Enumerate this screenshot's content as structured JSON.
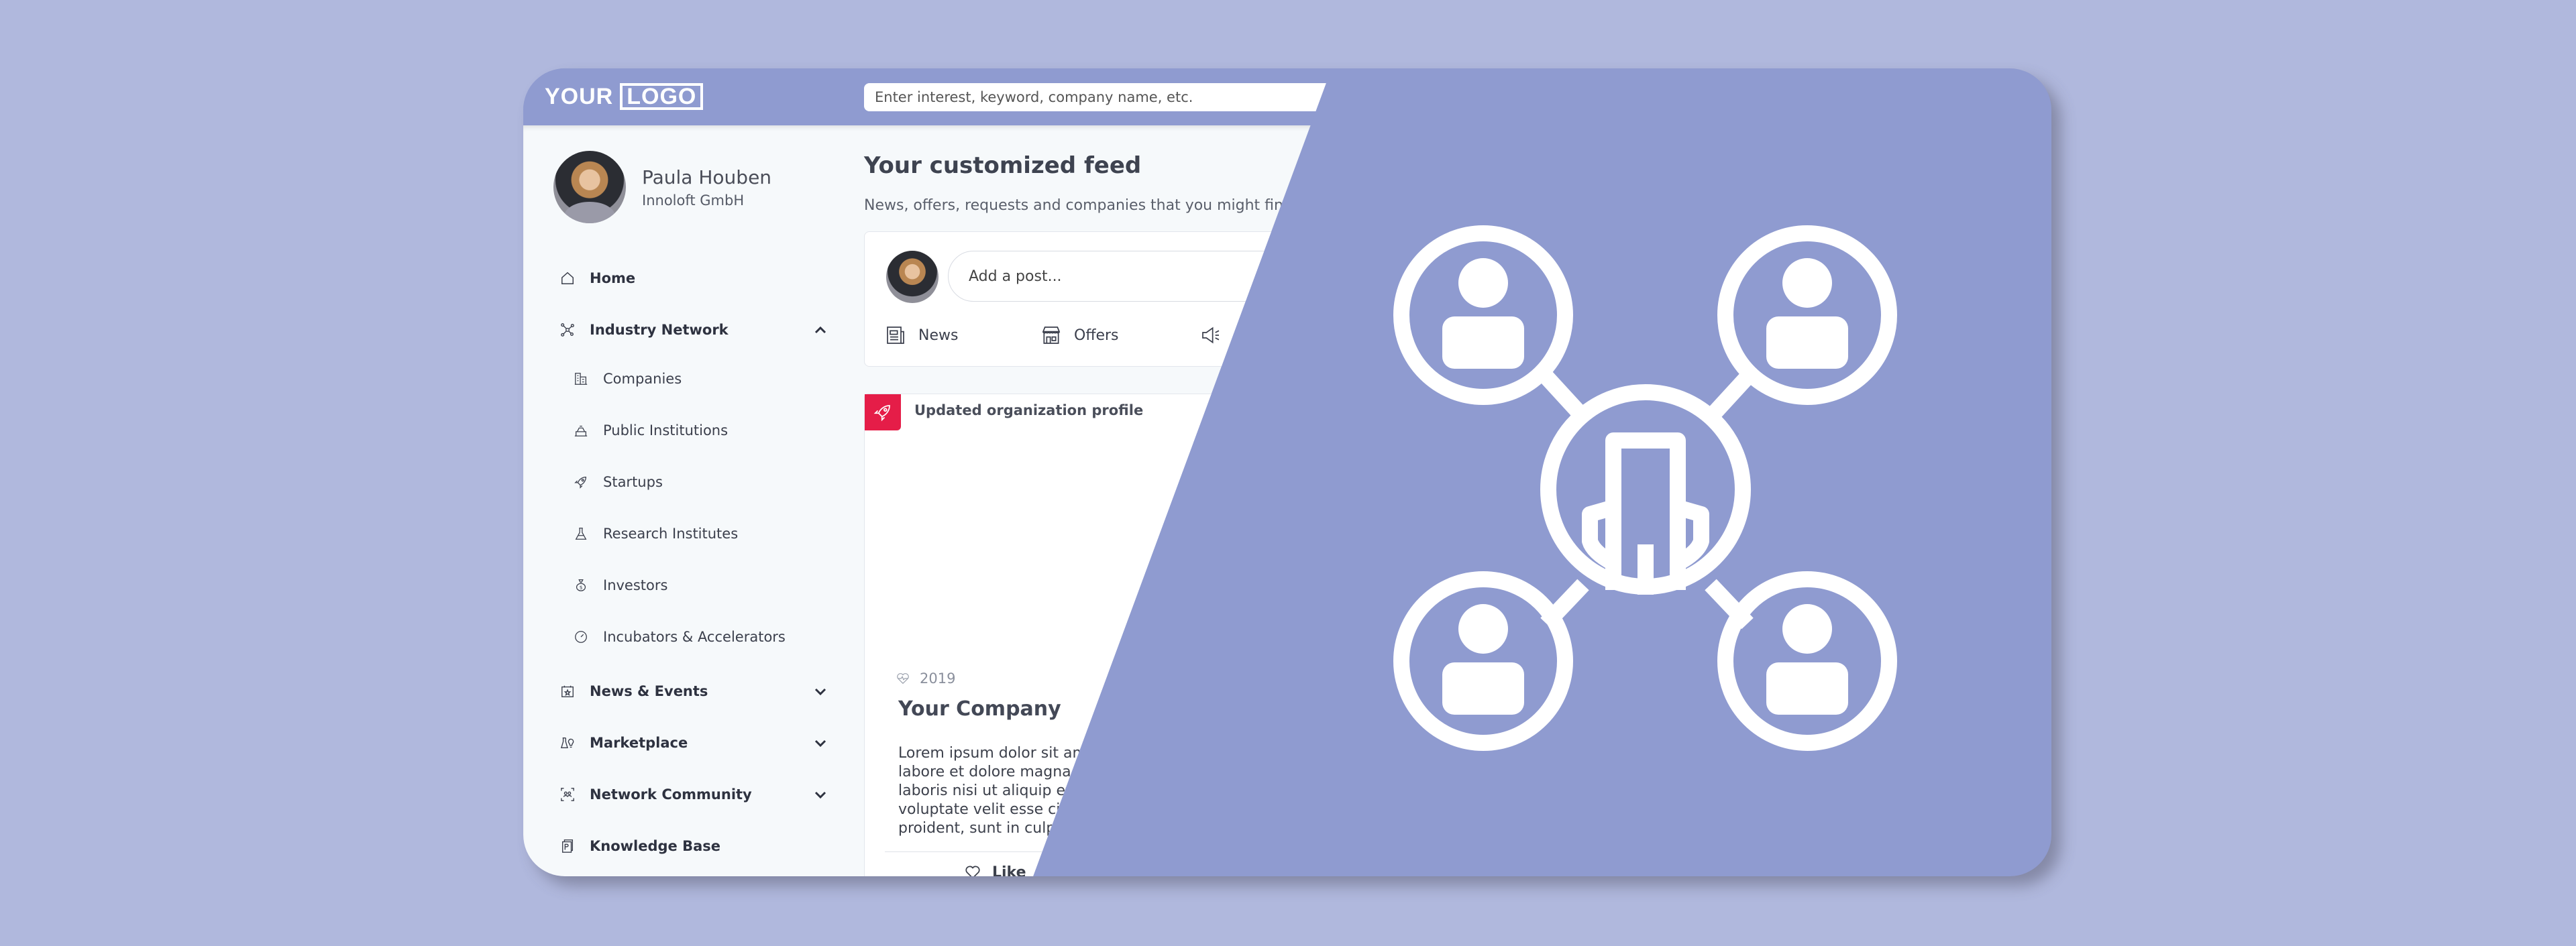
{
  "colors": {
    "background": "#b0b8dd",
    "brand": "#8f9bd0",
    "panel": "#f6f9fb",
    "accent_red": "#e51d48",
    "text_dark": "#2e3240"
  },
  "header": {
    "logo_text_plain": "YOUR",
    "logo_text_boxed": "LOGO",
    "search_placeholder": "Enter interest, keyword, company name, etc."
  },
  "profile": {
    "name": "Paula Houben",
    "organization": "Innoloft GmbH"
  },
  "sidebar": {
    "items": [
      {
        "label": "Home",
        "icon": "home-icon"
      },
      {
        "label": "Industry Network",
        "icon": "network-icon",
        "expanded": true,
        "children": [
          {
            "label": "Companies",
            "icon": "buildings-icon"
          },
          {
            "label": "Public Institutions",
            "icon": "institution-icon"
          },
          {
            "label": "Startups",
            "icon": "rocket-icon"
          },
          {
            "label": "Research Institutes",
            "icon": "flask-icon"
          },
          {
            "label": "Investors",
            "icon": "money-bag-icon"
          },
          {
            "label": "Incubators & Accelerators",
            "icon": "speedometer-icon"
          }
        ]
      },
      {
        "label": "News & Events",
        "icon": "calendar-star-icon",
        "expanded": false
      },
      {
        "label": "Marketplace",
        "icon": "marketplace-icon",
        "expanded": false
      },
      {
        "label": "Network Community",
        "icon": "community-icon",
        "expanded": false
      },
      {
        "label": "Knowledge Base",
        "icon": "book-icon"
      }
    ]
  },
  "feed": {
    "title": "Your customized feed",
    "subtitle": "News, offers, requests and companies that you might find",
    "composer": {
      "placeholder": "Add a post...",
      "actions": [
        {
          "label": "News",
          "icon": "newspaper-icon"
        },
        {
          "label": "Offers",
          "icon": "store-icon"
        },
        {
          "label": "",
          "icon": "megaphone-icon"
        }
      ]
    },
    "card": {
      "header": "Updated organization profile",
      "badge_icon": "rocket-icon",
      "year": "2019",
      "company": "Your Company",
      "body": "Lorem ipsum dolor sit am\nlabore et dolore magna a\nlaboris nisi ut aliquip ex\nvoluptate velit esse cillu\nproident, sunt in culpa",
      "like_label": "Like"
    }
  },
  "illustration": {
    "description": "network-diagram",
    "center_node": "building-icon",
    "outer_nodes": [
      "person-icon",
      "person-icon",
      "person-icon",
      "person-icon"
    ]
  }
}
